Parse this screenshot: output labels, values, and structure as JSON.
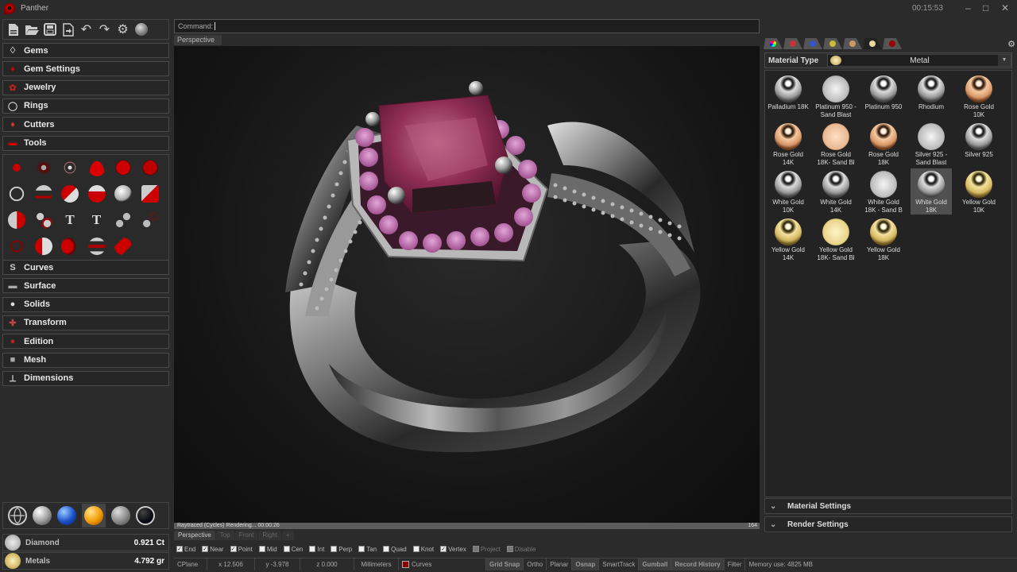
{
  "app": {
    "title": "Panther",
    "clock": "00:15:53",
    "window_controls": [
      "minimize-icon",
      "maximize-icon",
      "close-icon"
    ]
  },
  "toolbar": {
    "icons": [
      "new-file-icon",
      "open-folder-icon",
      "save-icon",
      "export-icon",
      "undo-icon",
      "redo-icon",
      "settings-gear-icon",
      "render-sphere-icon"
    ]
  },
  "sidebar": {
    "menus_top": [
      {
        "label": "Gems",
        "icon": "gem-outline-icon"
      },
      {
        "label": "Gem Settings",
        "icon": "gem-setting-icon"
      },
      {
        "label": "Jewelry",
        "icon": "jewelry-flower-icon"
      },
      {
        "label": "Rings",
        "icon": "ring-icon"
      },
      {
        "label": "Cutters",
        "icon": "cutter-gem-icon"
      },
      {
        "label": "Tools",
        "icon": "tools-icon"
      }
    ],
    "tools_grid": [
      "rail-tool-icon",
      "prong-grid-tool-icon",
      "halo-circle-tool-icon",
      "dome-tool-icon",
      "grid-sphere-tool-icon",
      "striped-sphere-tool-icon",
      "ring-size-tool-icon",
      "curve-bend-tool-icon",
      "shank-profile-tool-icon",
      "bezel-tool-icon",
      "sphere-tool-icon",
      "block-tool-icon",
      "flow-surface-tool-icon",
      "gem-pair-tool-icon",
      "text-3d-tool-icon",
      "text-tool-icon",
      "duplicate-gems-tool-icon",
      "gem-array-tool-icon",
      "dotted-ring-tool-icon",
      "box-tool-icon",
      "half-dome-tool-icon",
      "wave-tool-icon",
      "red-block-tool-icon"
    ],
    "menus_bottom": [
      {
        "label": "Curves",
        "icon": "curve-s-icon"
      },
      {
        "label": "Surface",
        "icon": "surface-icon"
      },
      {
        "label": "Solids",
        "icon": "solid-sphere-icon"
      },
      {
        "label": "Transform",
        "icon": "transform-axes-icon"
      },
      {
        "label": "Edition",
        "icon": "edition-icon"
      },
      {
        "label": "Mesh",
        "icon": "mesh-cube-icon"
      },
      {
        "label": "Dimensions",
        "icon": "dimensions-icon"
      }
    ],
    "display_modes": [
      "wireframe-mode-icon",
      "shaded-mode-icon",
      "blue-ball-mode-icon",
      "render-mode-icon",
      "ghosted-mode-icon",
      "dark-mode-icon"
    ],
    "stats": [
      {
        "label": "Diamond",
        "value": "0.921 Ct"
      },
      {
        "label": "Metals",
        "value": "4.792 gr"
      }
    ]
  },
  "command": {
    "label": "Command:"
  },
  "viewport": {
    "name": "Perspective",
    "render_status": "Raytraced (Cycles)   Rendering...   00:00:26",
    "render_progress_pct": 100,
    "sample_count": "164",
    "tabs": [
      "Perspective",
      "Top",
      "Front",
      "Right",
      "+"
    ],
    "active_tab": 0,
    "colors": {
      "gem": "#9b2d5c",
      "halo": "#c67ab5",
      "metal": "#c8c8c8"
    }
  },
  "osnap": [
    {
      "label": "End",
      "checked": true
    },
    {
      "label": "Near",
      "checked": true
    },
    {
      "label": "Point",
      "checked": true
    },
    {
      "label": "Mid",
      "checked": false
    },
    {
      "label": "Cen",
      "checked": false
    },
    {
      "label": "Int",
      "checked": false
    },
    {
      "label": "Perp",
      "checked": false
    },
    {
      "label": "Tan",
      "checked": false
    },
    {
      "label": "Quad",
      "checked": false
    },
    {
      "label": "Knot",
      "checked": false
    },
    {
      "label": "Vertex",
      "checked": true
    },
    {
      "label": "Project",
      "checked": false,
      "disabled": true
    },
    {
      "label": "Disable",
      "checked": false,
      "disabled": true
    }
  ],
  "statusbar": {
    "cplane": "CPlane",
    "x": "x 12.506",
    "y": "y -3.978",
    "z": "z 0.000",
    "units": "Millimeters",
    "layer": "Curves",
    "layer_color": "#8b0000",
    "toggles": [
      {
        "label": "Grid Snap",
        "on": true
      },
      {
        "label": "Ortho",
        "on": false
      },
      {
        "label": "Planar",
        "on": false
      },
      {
        "label": "Osnap",
        "on": true
      },
      {
        "label": "SmartTrack",
        "on": false
      },
      {
        "label": "Gumball",
        "on": true
      },
      {
        "label": "Record History",
        "on": true
      },
      {
        "label": "Filter",
        "on": false
      }
    ],
    "memory": "Memory use: 4825 MB"
  },
  "material_panel": {
    "tabs": [
      "color-wheel-tab-icon",
      "red-gem-tab-icon",
      "blue-potion-tab-icon",
      "folder-tab-icon",
      "brush-tab-icon",
      "metal-tab-icon",
      "red-sphere-tab-icon"
    ],
    "active_tab": 5,
    "type_label": "Material Type",
    "type_value": "Metal",
    "materials": [
      {
        "name": "Palladium 18K",
        "color": "silver",
        "sand": false
      },
      {
        "name": "Platinum 950 - Sand Blast",
        "color": "silver",
        "sand": true
      },
      {
        "name": "Platinum 950",
        "color": "silver",
        "sand": false
      },
      {
        "name": "Rhodium",
        "color": "silver",
        "sand": false
      },
      {
        "name": "Rose Gold 10K",
        "color": "rose",
        "sand": false
      },
      {
        "name": "Rose Gold 14K",
        "color": "rose",
        "sand": false
      },
      {
        "name": "Rose Gold 18K- Sand Bl",
        "color": "rose",
        "sand": true
      },
      {
        "name": "Rose Gold 18K",
        "color": "rose",
        "sand": false
      },
      {
        "name": "Silver 925 - Sand Blast",
        "color": "silver",
        "sand": true
      },
      {
        "name": "Silver 925",
        "color": "silver",
        "sand": false
      },
      {
        "name": "White Gold 10K",
        "color": "silver",
        "sand": false
      },
      {
        "name": "White Gold 14K",
        "color": "silver",
        "sand": false
      },
      {
        "name": "White Gold 18K - Sand B",
        "color": "silver",
        "sand": true
      },
      {
        "name": "White Gold 18K",
        "color": "silver",
        "sand": false,
        "selected": true
      },
      {
        "name": "Yellow Gold 10K",
        "color": "yellow",
        "sand": false
      },
      {
        "name": "Yellow Gold 14K",
        "color": "yellow",
        "sand": false
      },
      {
        "name": "Yellow Gold 18K- Sand Bl",
        "color": "yellow",
        "sand": true
      },
      {
        "name": "Yellow Gold 18K",
        "color": "yellow",
        "sand": false
      }
    ],
    "sections": [
      "Material Settings",
      "Render Settings"
    ]
  }
}
